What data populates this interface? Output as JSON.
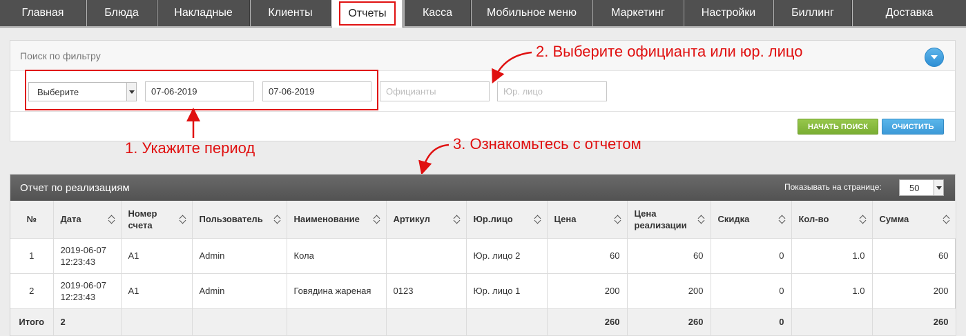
{
  "nav": {
    "tabs": [
      {
        "label": "Главная"
      },
      {
        "label": "Блюда"
      },
      {
        "label": "Накладные"
      },
      {
        "label": "Клиенты"
      },
      {
        "label": "Отчеты"
      },
      {
        "label": "Касса"
      },
      {
        "label": "Мобильное меню"
      },
      {
        "label": "Маркетинг"
      },
      {
        "label": "Настройки"
      },
      {
        "label": "Биллинг"
      },
      {
        "label": "Доставка"
      }
    ],
    "active": "Отчеты"
  },
  "filter": {
    "title": "Поиск по фильтру",
    "period_select": "Выберите",
    "date_from": "07-06-2019",
    "date_to": "07-06-2019",
    "waiters_placeholder": "Официанты",
    "legal_placeholder": "Юр. лицо",
    "search_button": "НАЧАТЬ ПОИСК",
    "clear_button": "ОЧИСТИТЬ"
  },
  "annotations": {
    "step1": "1. Укажите период",
    "step2": "2. Выберите официанта или юр. лицо",
    "step3": "3. Ознакомьтесь с отчетом"
  },
  "report": {
    "title": "Отчет по реализациям",
    "per_page_label": "Показывать на странице:",
    "per_page_value": "50",
    "columns": [
      "№",
      "Дата",
      "Номер счета",
      "Пользователь",
      "Наименование",
      "Артикул",
      "Юр.лицо",
      "Цена",
      "Цена реализации",
      "Скидка",
      "Кол-во",
      "Сумма"
    ],
    "rows": [
      [
        "1",
        "2019-06-07 12:23:43",
        "A1",
        "Admin",
        "Кола",
        "",
        "Юр. лицо 2",
        "60",
        "60",
        "0",
        "1.0",
        "60"
      ],
      [
        "2",
        "2019-06-07 12:23:43",
        "A1",
        "Admin",
        "Говядина жареная",
        "0123",
        "Юр. лицо 1",
        "200",
        "200",
        "0",
        "1.0",
        "200"
      ]
    ],
    "total": [
      "Итого",
      "2",
      "",
      "",
      "",
      "",
      "",
      "260",
      "260",
      "0",
      "",
      "260"
    ]
  },
  "colors": {
    "nav_tab": "#505050",
    "highlight": "#e01010",
    "search_button": "#8bbd3f",
    "clear_button": "#4ba8e2"
  }
}
